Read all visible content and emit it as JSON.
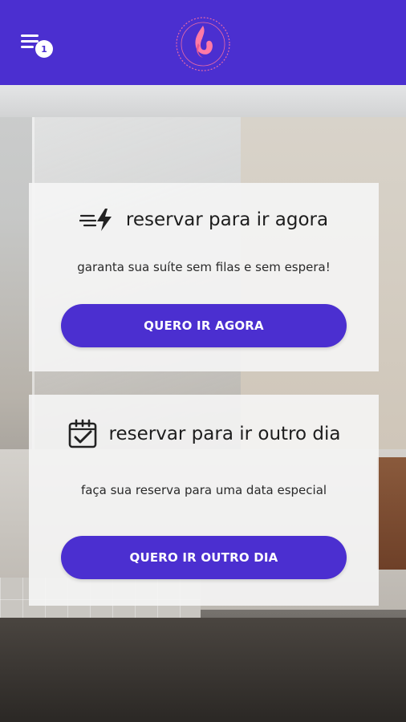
{
  "topbar": {
    "menu_badge": "1",
    "accent_color": "#4b2fd0",
    "logo_icon": "flame-logo",
    "menu_icon": "menu-list-icon"
  },
  "now_card": {
    "icon": "lightning-speed-icon",
    "title": "reservar para ir agora",
    "subtitle": "garanta sua suíte sem filas e sem espera!",
    "button_label": "QUERO IR AGORA"
  },
  "other_day_card": {
    "icon": "calendar-check-icon",
    "title": "reservar para ir outro dia",
    "subtitle": "faça sua reserva para uma data especial",
    "button_label": "QUERO IR OUTRO DIA"
  }
}
